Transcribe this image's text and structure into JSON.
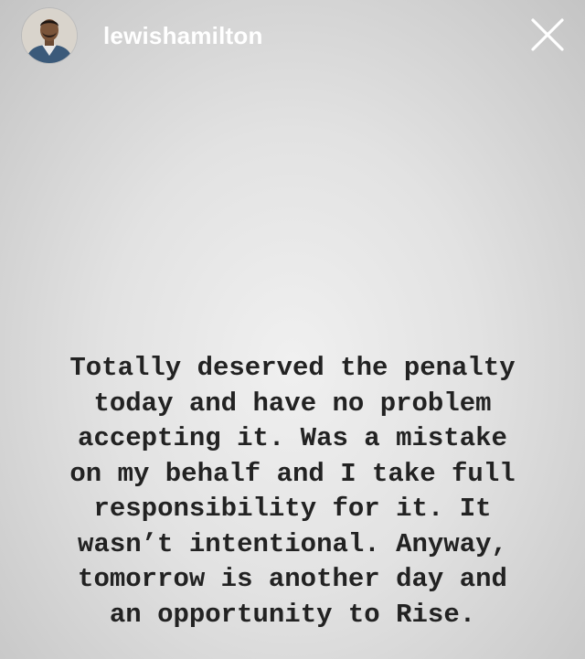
{
  "story": {
    "username": "lewishamilton",
    "avatar": {
      "icon": "profile-avatar",
      "accent": "#3b5a7a"
    },
    "close_icon": "close-icon",
    "caption_lines": [
      "Totally deserved the penalty",
      "today and have no problem",
      "accepting it. Was a mistake",
      "on my behalf and I take full",
      "responsibility for it. It",
      "wasn’t intentional. Anyway,",
      "tomorrow is another day and",
      "an opportunity to Rise."
    ]
  }
}
